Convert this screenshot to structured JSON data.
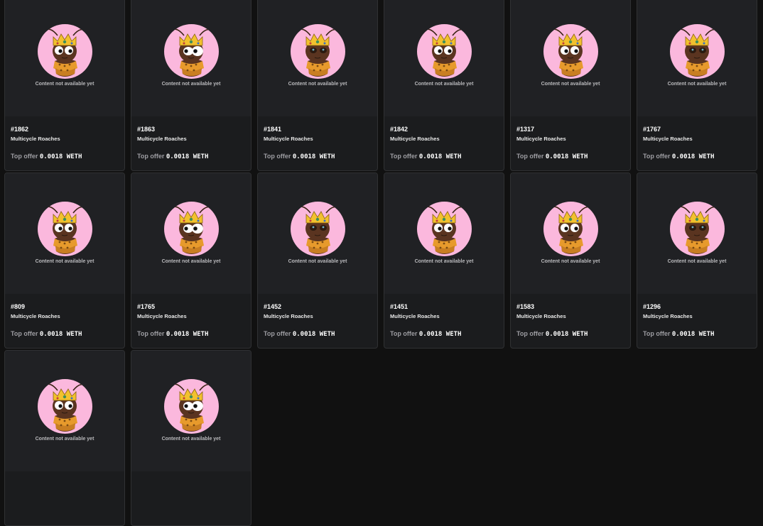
{
  "nfts": [
    {
      "token": "#1862",
      "collection": "Multicycle Roaches",
      "offer_label": "Top offer",
      "offer_price": "0.0018 WETH",
      "media_text": "Content not available yet",
      "face": "left"
    },
    {
      "token": "#1863",
      "collection": "Multicycle Roaches",
      "offer_label": "Top offer",
      "offer_price": "0.0018 WETH",
      "media_text": "Content not available yet",
      "face": "side"
    },
    {
      "token": "#1841",
      "collection": "Multicycle Roaches",
      "offer_label": "Top offer",
      "offer_price": "0.0018 WETH",
      "media_text": "Content not available yet",
      "face": "front"
    },
    {
      "token": "#1842",
      "collection": "Multicycle Roaches",
      "offer_label": "Top offer",
      "offer_price": "0.0018 WETH",
      "media_text": "Content not available yet",
      "face": "left"
    },
    {
      "token": "#1317",
      "collection": "Multicycle Roaches",
      "offer_label": "Top offer",
      "offer_price": "0.0018 WETH",
      "media_text": "Content not available yet",
      "face": "left"
    },
    {
      "token": "#1767",
      "collection": "Multicycle Roaches",
      "offer_label": "Top offer",
      "offer_price": "0.0018 WETH",
      "media_text": "Content not available yet",
      "face": "front"
    },
    {
      "token": "#809",
      "collection": "Multicycle Roaches",
      "offer_label": "Top offer",
      "offer_price": "0.0018 WETH",
      "media_text": "Content not available yet",
      "face": "left"
    },
    {
      "token": "#1765",
      "collection": "Multicycle Roaches",
      "offer_label": "Top offer",
      "offer_price": "0.0018 WETH",
      "media_text": "Content not available yet",
      "face": "side"
    },
    {
      "token": "#1452",
      "collection": "Multicycle Roaches",
      "offer_label": "Top offer",
      "offer_price": "0.0018 WETH",
      "media_text": "Content not available yet",
      "face": "front"
    },
    {
      "token": "#1451",
      "collection": "Multicycle Roaches",
      "offer_label": "Top offer",
      "offer_price": "0.0018 WETH",
      "media_text": "Content not available yet",
      "face": "left"
    },
    {
      "token": "#1583",
      "collection": "Multicycle Roaches",
      "offer_label": "Top offer",
      "offer_price": "0.0018 WETH",
      "media_text": "Content not available yet",
      "face": "left"
    },
    {
      "token": "#1296",
      "collection": "Multicycle Roaches",
      "offer_label": "Top offer",
      "offer_price": "0.0018 WETH",
      "media_text": "Content not available yet",
      "face": "front"
    },
    {
      "token": "",
      "collection": "",
      "offer_label": "",
      "offer_price": "",
      "media_text": "Content not available yet",
      "face": "left"
    },
    {
      "token": "",
      "collection": "",
      "offer_label": "",
      "offer_price": "",
      "media_text": "Content not available yet",
      "face": "side"
    }
  ],
  "colors": {
    "page_bg": "#111111",
    "card_bg": "#1b1c1e",
    "media_bg": "#202124",
    "avatar_bg": "#fbb8dd",
    "crown": "#f2c12e",
    "roach_body": "#5a3420",
    "scarf": "#e79a2c"
  },
  "icons": {
    "avatar": "roach-king-avatar"
  }
}
